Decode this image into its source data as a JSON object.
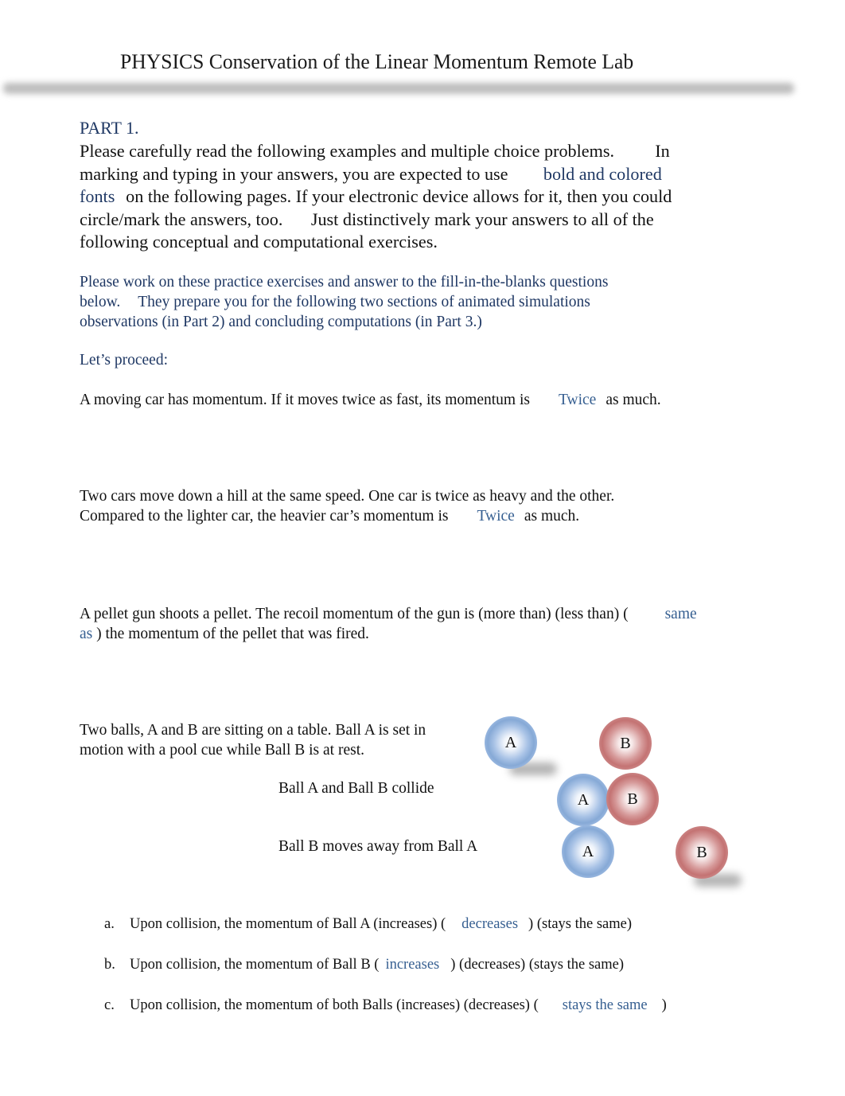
{
  "document": {
    "title": "PHYSICS Conservation of the Linear Momentum Remote Lab",
    "part_heading": "PART 1.",
    "intro": {
      "line1_a": "Please carefully read the following examples and multiple choice problems.",
      "line1_b": "In",
      "line2_a": "marking and typing in your answers, you are expected to use",
      "line2_b": "bold and colored",
      "line3_a": "fonts",
      "line3_b": "on the following pages. If your electronic device allows for it, then you could",
      "line4_a": "circle/mark the answers, too.",
      "line4_b": "Just distinctively mark your answers to all of the",
      "line5": "following conceptual and computational exercises."
    },
    "instructions": {
      "line1": "Please work on these practice exercises and answer to the fill-in-the-blanks questions",
      "line2_a": "below.",
      "line2_b": "They prepare you for the following two sections of animated simulations",
      "line3": "observations (in Part 2) and concluding computations (in Part 3.)",
      "proceed": "Let’s proceed:"
    },
    "questions": [
      {
        "before": "A moving car has momentum. If it moves twice as fast, its momentum is",
        "answer": "Twice",
        "after": "as much."
      },
      {
        "line1": "Two cars move down a hill at the same speed. One car is twice as heavy and the other.",
        "before": "Compared to the lighter car, the heavier car’s momentum is",
        "answer": "Twice",
        "after": "as much."
      },
      {
        "before": "A pellet gun shoots a pellet. The recoil momentum of the gun is (more than) (less than) (",
        "answer_part1": "same",
        "answer_part2": "as",
        "after": ") the momentum of the pellet that was fired."
      }
    ],
    "balls_problem": {
      "intro_line1": "Two balls, A and B are sitting on a table. Ball A is set in",
      "intro_line2": "motion with a pool cue while Ball B is at rest.",
      "step2": "Ball A and Ball B collide",
      "step3": "Ball B moves away from Ball A",
      "ball_a_label": "A",
      "ball_b_label": "B",
      "ball_a_color": "#86a9d6",
      "ball_b_color": "#c47373"
    },
    "options": [
      {
        "marker": "a.",
        "before": "Upon collision, the momentum of Ball A (increases) (",
        "answer": "decreases",
        "after": ") (stays the same)"
      },
      {
        "marker": "b.",
        "before": "Upon collision, the momentum of Ball B (",
        "answer": "increases",
        "after": ") (decreases) (stays the same)"
      },
      {
        "marker": "c.",
        "before": "Upon collision, the momentum of both Balls (increases) (decreases) (",
        "answer": "stays the same",
        "after": ")"
      }
    ],
    "colors": {
      "heading_navy": "#1f3864",
      "answer_blue": "#365f91"
    }
  }
}
